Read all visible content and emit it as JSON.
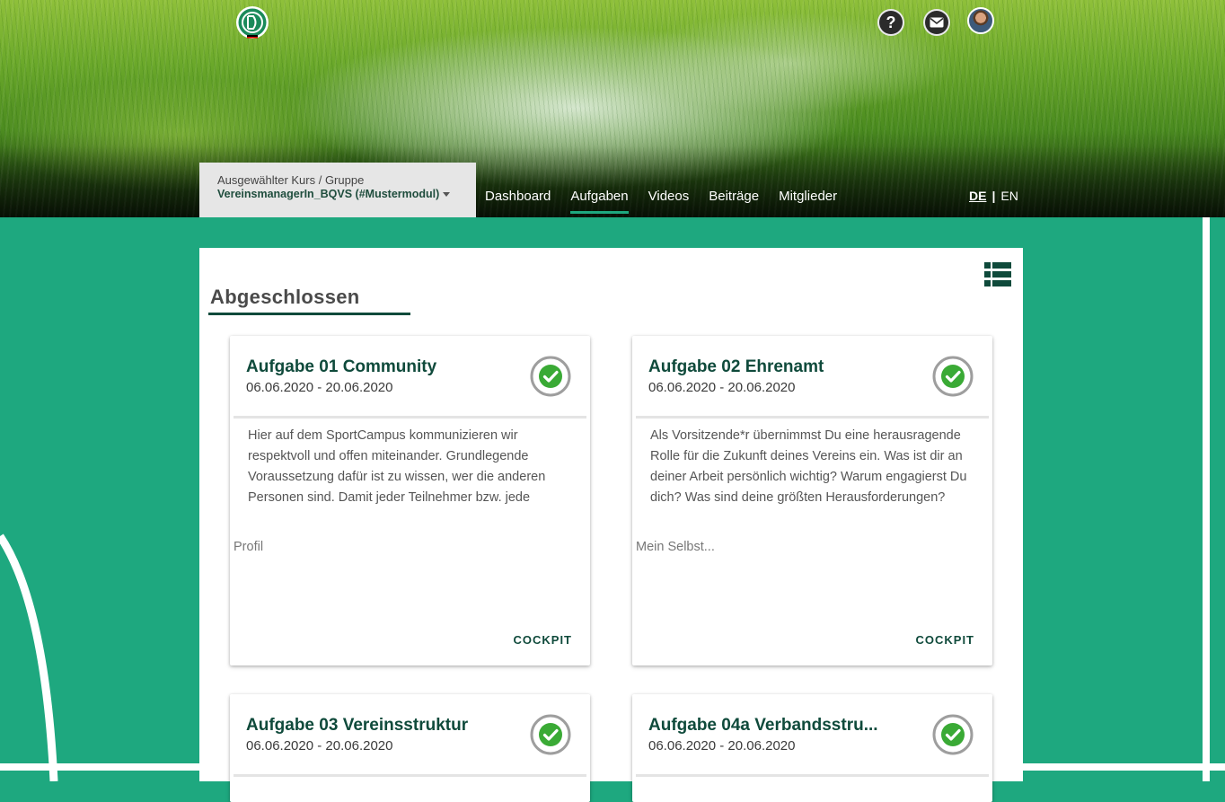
{
  "header": {
    "course_label": "Ausgewählter Kurs / Gruppe",
    "course_value": "VereinsmanagerIn_BQVS (#Mustermodul)",
    "help_glyph": "?",
    "nav": [
      {
        "label": "Dashboard"
      },
      {
        "label": "Aufgaben"
      },
      {
        "label": "Videos"
      },
      {
        "label": "Beiträge"
      },
      {
        "label": "Mitglieder"
      }
    ],
    "lang_de": "DE",
    "lang_sep": "|",
    "lang_en": "EN"
  },
  "main": {
    "section_title": "Abgeschlossen",
    "cards": [
      {
        "title": "Aufgabe 01 Community",
        "date": "06.06.2020 - 20.06.2020",
        "text": "Hier auf dem SportCampus kommunizieren wir respektvoll und offen miteinander. Grundlegende Voraussetzung dafür ist zu wissen, wer die anderen Personen sind. Damit jeder Teilnehmer bzw. jede",
        "link": "Profil",
        "cockpit": "COCKPIT"
      },
      {
        "title": "Aufgabe 02 Ehrenamt",
        "date": "06.06.2020 - 20.06.2020",
        "text": "Als Vorsitzende*r übernimmst Du eine herausragende Rolle für die Zukunft deines Vereins ein. Was ist dir an deiner Arbeit persönlich wichtig? Warum engagierst Du dich? Was sind deine größten Herausforderungen?",
        "link": "Mein Selbst...",
        "cockpit": "COCKPIT"
      },
      {
        "title": "Aufgabe 03 Vereinsstruktur",
        "date": "06.06.2020 - 20.06.2020"
      },
      {
        "title": "Aufgabe 04a Verbandsstru...",
        "date": "06.06.2020 - 20.06.2020"
      }
    ]
  },
  "colors": {
    "brand_green": "#1ea87f",
    "dark_green": "#0f4a3b",
    "check_green": "#3aaa35"
  },
  "icons": [
    "dfb-logo-icon",
    "help-icon",
    "mail-icon",
    "user-avatar",
    "list-view-icon",
    "check-icon"
  ]
}
